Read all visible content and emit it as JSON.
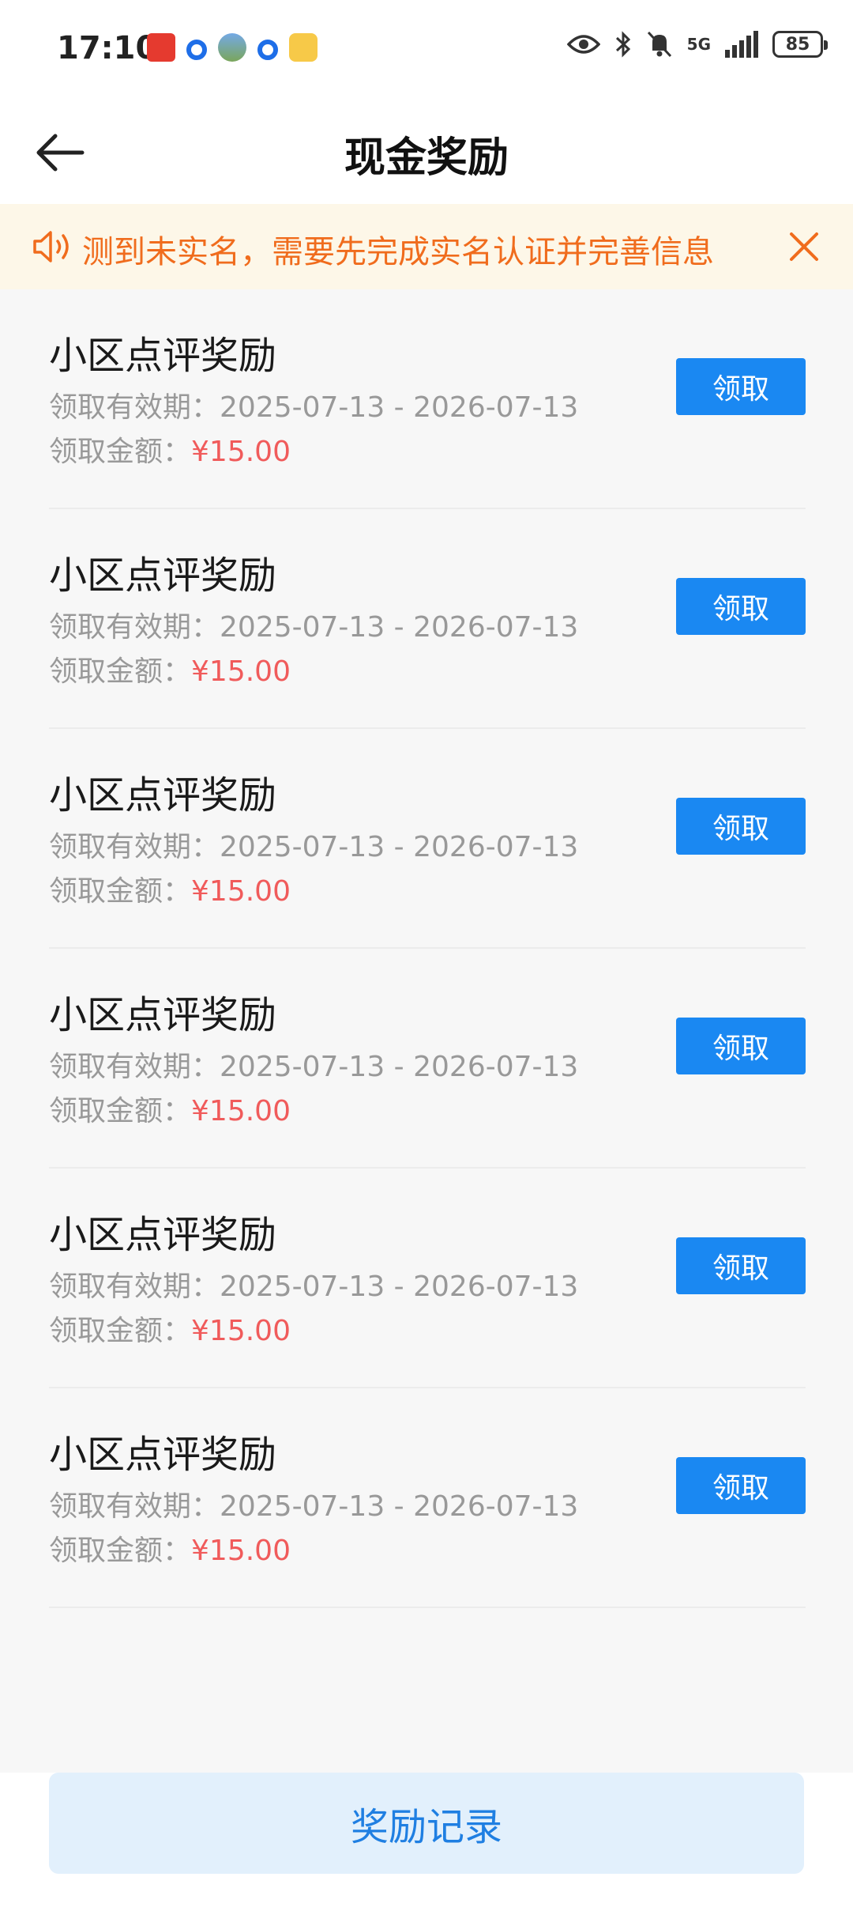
{
  "status_bar": {
    "time": "17:10",
    "network": "5G",
    "battery": "85"
  },
  "header": {
    "title": "现金奖励"
  },
  "notice": {
    "text": "测到未实名，需要先完成实名认证并完善信息"
  },
  "colors": {
    "primary": "#1a88f2",
    "notice_text": "#f06c1d",
    "notice_bg": "#fdf7e8",
    "amount": "#f05b5b"
  },
  "rewards": [
    {
      "title": "小区点评奖励",
      "period_label": "领取有效期：",
      "period": "2025-07-13 - 2026-07-13",
      "amount_label": "领取金额：",
      "amount": "¥15.00",
      "button": "领取"
    },
    {
      "title": "小区点评奖励",
      "period_label": "领取有效期：",
      "period": "2025-07-13 - 2026-07-13",
      "amount_label": "领取金额：",
      "amount": "¥15.00",
      "button": "领取"
    },
    {
      "title": "小区点评奖励",
      "period_label": "领取有效期：",
      "period": "2025-07-13 - 2026-07-13",
      "amount_label": "领取金额：",
      "amount": "¥15.00",
      "button": "领取"
    },
    {
      "title": "小区点评奖励",
      "period_label": "领取有效期：",
      "period": "2025-07-13 - 2026-07-13",
      "amount_label": "领取金额：",
      "amount": "¥15.00",
      "button": "领取"
    },
    {
      "title": "小区点评奖励",
      "period_label": "领取有效期：",
      "period": "2025-07-13 - 2026-07-13",
      "amount_label": "领取金额：",
      "amount": "¥15.00",
      "button": "领取"
    },
    {
      "title": "小区点评奖励",
      "period_label": "领取有效期：",
      "period": "2025-07-13 - 2026-07-13",
      "amount_label": "领取金额：",
      "amount": "¥15.00",
      "button": "领取"
    }
  ],
  "footer": {
    "records_label": "奖励记录"
  }
}
